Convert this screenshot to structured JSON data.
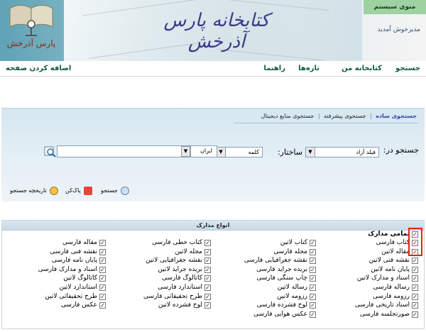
{
  "header": {
    "title": "کتابخانه پارس آذرخش",
    "logo_text": "پارس آذرخش",
    "menu_system": "منوی سیستم",
    "welcome": "مدیرخوش آمدید"
  },
  "nav": {
    "items": [
      "جستجو",
      "کتابخانه من",
      "تازه‌ها",
      "راهنما",
      "اضافه کردن صفحه"
    ]
  },
  "search": {
    "tabs": [
      "جستجوی ساده",
      "جستجوی پیشرفته",
      "جستجوی منابع دیجیتال"
    ],
    "query_label": "جستجو در:",
    "field_select": "فیلد آزاد",
    "struct_label": "ساختار:",
    "struct_select": "کلمه",
    "lang_select": "ایران",
    "input_value": "",
    "buttons": {
      "search": "جستجو",
      "clear": "پاک‌کن",
      "history": "تاریخچه جستجو"
    }
  },
  "docs": {
    "header": "انواع مدارک",
    "all_label": "تمامی مدارک",
    "columns": [
      [
        "کتاب فارسی",
        "مقاله لاتین",
        "نقشه فنی لاتین",
        "پایان نامه لاتین",
        "اسناد و مدارک لاتین",
        "رساله فارسی",
        "رزومه فارسی",
        "اسناد تاریخی فارسی",
        "صورتجلسه فارسی"
      ],
      [
        "کتاب لاتین",
        "مجله فارسی",
        "نقشه جغرافیایی فارسی",
        "بریده جراید فارسی",
        "چاپ سنگی فارسی",
        "رساله لاتین",
        "رزومه لاتین",
        "لوح فشرده فارسی",
        "عکس هوایی فارسی"
      ],
      [
        "کتاب خطی فارسی",
        "مجله لاتین",
        "نقشه جغرافیایی لاتین",
        "بریده جراید لاتین",
        "کاتالوگ فارسی",
        "استاندارد فارسی",
        "طرح تحقیقاتی فارسی",
        "لوح فشرده لاتین"
      ],
      [
        "مقاله فارسی",
        "نقشه فنی فارسی",
        "پایان نامه فارسی",
        "اسناد و مدارک فارسی",
        "کاتالوگ لاتین",
        "استاندارد لاتین",
        "طرح تحقیقاتی لاتین",
        "عکس فارسی"
      ]
    ]
  },
  "colors": {
    "accent": "#0f5a3a",
    "tab_active": "#2b44a8",
    "highlight": "#e0241b",
    "menu_bg": "#9ed2a1"
  }
}
